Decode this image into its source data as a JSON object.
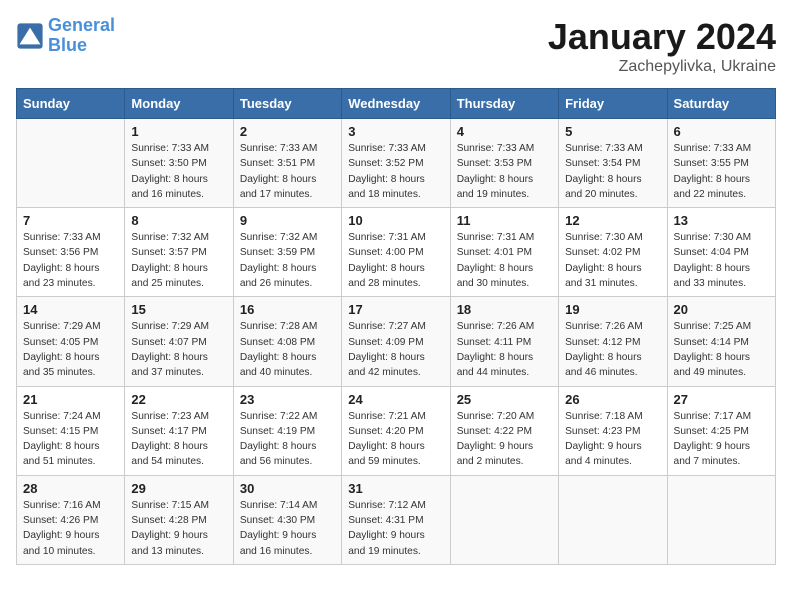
{
  "header": {
    "logo_general": "General",
    "logo_blue": "Blue",
    "month": "January 2024",
    "location": "Zachepylivka, Ukraine"
  },
  "days_of_week": [
    "Sunday",
    "Monday",
    "Tuesday",
    "Wednesday",
    "Thursday",
    "Friday",
    "Saturday"
  ],
  "weeks": [
    [
      {
        "day": "",
        "info": ""
      },
      {
        "day": "1",
        "info": "Sunrise: 7:33 AM\nSunset: 3:50 PM\nDaylight: 8 hours\nand 16 minutes."
      },
      {
        "day": "2",
        "info": "Sunrise: 7:33 AM\nSunset: 3:51 PM\nDaylight: 8 hours\nand 17 minutes."
      },
      {
        "day": "3",
        "info": "Sunrise: 7:33 AM\nSunset: 3:52 PM\nDaylight: 8 hours\nand 18 minutes."
      },
      {
        "day": "4",
        "info": "Sunrise: 7:33 AM\nSunset: 3:53 PM\nDaylight: 8 hours\nand 19 minutes."
      },
      {
        "day": "5",
        "info": "Sunrise: 7:33 AM\nSunset: 3:54 PM\nDaylight: 8 hours\nand 20 minutes."
      },
      {
        "day": "6",
        "info": "Sunrise: 7:33 AM\nSunset: 3:55 PM\nDaylight: 8 hours\nand 22 minutes."
      }
    ],
    [
      {
        "day": "7",
        "info": "Sunrise: 7:33 AM\nSunset: 3:56 PM\nDaylight: 8 hours\nand 23 minutes."
      },
      {
        "day": "8",
        "info": "Sunrise: 7:32 AM\nSunset: 3:57 PM\nDaylight: 8 hours\nand 25 minutes."
      },
      {
        "day": "9",
        "info": "Sunrise: 7:32 AM\nSunset: 3:59 PM\nDaylight: 8 hours\nand 26 minutes."
      },
      {
        "day": "10",
        "info": "Sunrise: 7:31 AM\nSunset: 4:00 PM\nDaylight: 8 hours\nand 28 minutes."
      },
      {
        "day": "11",
        "info": "Sunrise: 7:31 AM\nSunset: 4:01 PM\nDaylight: 8 hours\nand 30 minutes."
      },
      {
        "day": "12",
        "info": "Sunrise: 7:30 AM\nSunset: 4:02 PM\nDaylight: 8 hours\nand 31 minutes."
      },
      {
        "day": "13",
        "info": "Sunrise: 7:30 AM\nSunset: 4:04 PM\nDaylight: 8 hours\nand 33 minutes."
      }
    ],
    [
      {
        "day": "14",
        "info": "Sunrise: 7:29 AM\nSunset: 4:05 PM\nDaylight: 8 hours\nand 35 minutes."
      },
      {
        "day": "15",
        "info": "Sunrise: 7:29 AM\nSunset: 4:07 PM\nDaylight: 8 hours\nand 37 minutes."
      },
      {
        "day": "16",
        "info": "Sunrise: 7:28 AM\nSunset: 4:08 PM\nDaylight: 8 hours\nand 40 minutes."
      },
      {
        "day": "17",
        "info": "Sunrise: 7:27 AM\nSunset: 4:09 PM\nDaylight: 8 hours\nand 42 minutes."
      },
      {
        "day": "18",
        "info": "Sunrise: 7:26 AM\nSunset: 4:11 PM\nDaylight: 8 hours\nand 44 minutes."
      },
      {
        "day": "19",
        "info": "Sunrise: 7:26 AM\nSunset: 4:12 PM\nDaylight: 8 hours\nand 46 minutes."
      },
      {
        "day": "20",
        "info": "Sunrise: 7:25 AM\nSunset: 4:14 PM\nDaylight: 8 hours\nand 49 minutes."
      }
    ],
    [
      {
        "day": "21",
        "info": "Sunrise: 7:24 AM\nSunset: 4:15 PM\nDaylight: 8 hours\nand 51 minutes."
      },
      {
        "day": "22",
        "info": "Sunrise: 7:23 AM\nSunset: 4:17 PM\nDaylight: 8 hours\nand 54 minutes."
      },
      {
        "day": "23",
        "info": "Sunrise: 7:22 AM\nSunset: 4:19 PM\nDaylight: 8 hours\nand 56 minutes."
      },
      {
        "day": "24",
        "info": "Sunrise: 7:21 AM\nSunset: 4:20 PM\nDaylight: 8 hours\nand 59 minutes."
      },
      {
        "day": "25",
        "info": "Sunrise: 7:20 AM\nSunset: 4:22 PM\nDaylight: 9 hours\nand 2 minutes."
      },
      {
        "day": "26",
        "info": "Sunrise: 7:18 AM\nSunset: 4:23 PM\nDaylight: 9 hours\nand 4 minutes."
      },
      {
        "day": "27",
        "info": "Sunrise: 7:17 AM\nSunset: 4:25 PM\nDaylight: 9 hours\nand 7 minutes."
      }
    ],
    [
      {
        "day": "28",
        "info": "Sunrise: 7:16 AM\nSunset: 4:26 PM\nDaylight: 9 hours\nand 10 minutes."
      },
      {
        "day": "29",
        "info": "Sunrise: 7:15 AM\nSunset: 4:28 PM\nDaylight: 9 hours\nand 13 minutes."
      },
      {
        "day": "30",
        "info": "Sunrise: 7:14 AM\nSunset: 4:30 PM\nDaylight: 9 hours\nand 16 minutes."
      },
      {
        "day": "31",
        "info": "Sunrise: 7:12 AM\nSunset: 4:31 PM\nDaylight: 9 hours\nand 19 minutes."
      },
      {
        "day": "",
        "info": ""
      },
      {
        "day": "",
        "info": ""
      },
      {
        "day": "",
        "info": ""
      }
    ]
  ]
}
